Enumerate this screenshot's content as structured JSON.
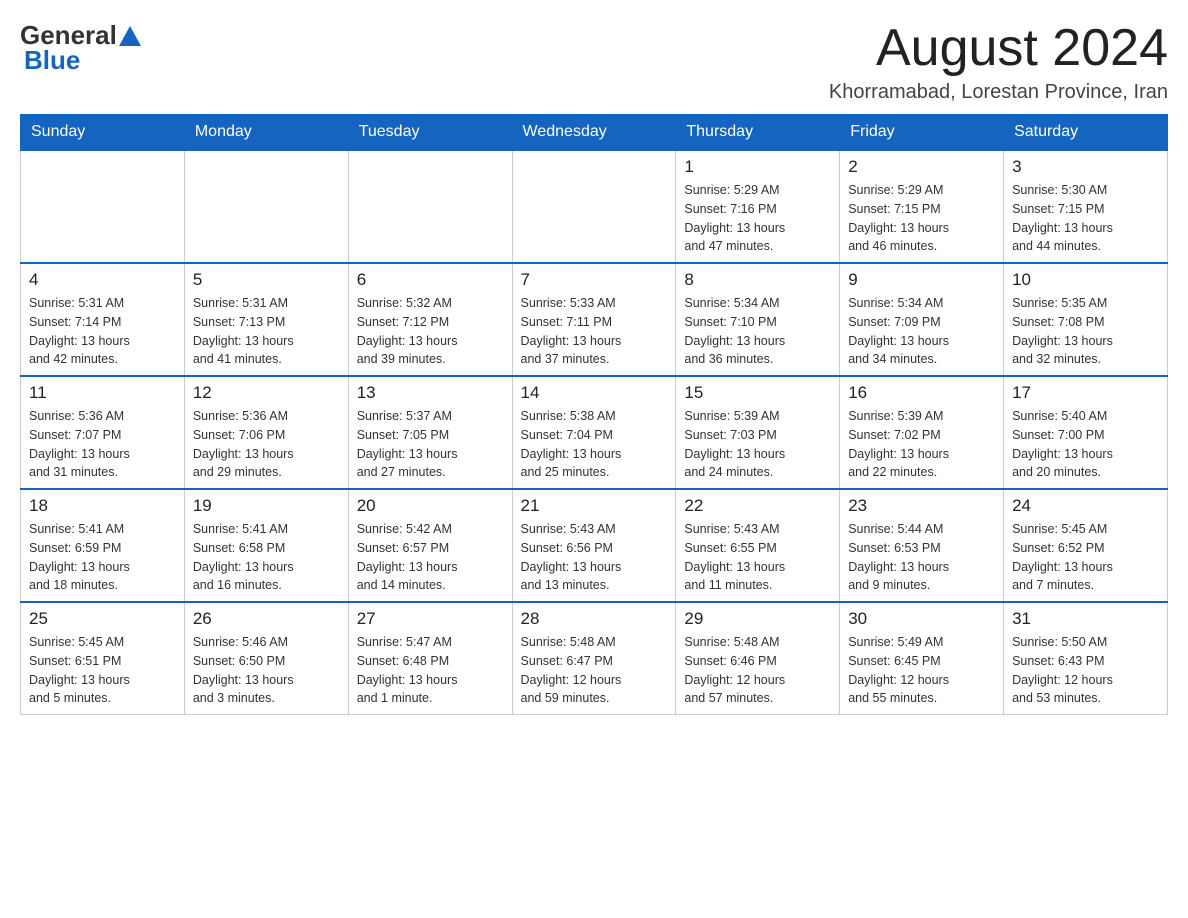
{
  "header": {
    "logo": {
      "text_general": "General",
      "text_blue": "Blue"
    },
    "title": "August 2024",
    "location": "Khorramabad, Lorestan Province, Iran"
  },
  "days_of_week": [
    "Sunday",
    "Monday",
    "Tuesday",
    "Wednesday",
    "Thursday",
    "Friday",
    "Saturday"
  ],
  "weeks": [
    [
      {
        "day": "",
        "info": ""
      },
      {
        "day": "",
        "info": ""
      },
      {
        "day": "",
        "info": ""
      },
      {
        "day": "",
        "info": ""
      },
      {
        "day": "1",
        "info": "Sunrise: 5:29 AM\nSunset: 7:16 PM\nDaylight: 13 hours\nand 47 minutes."
      },
      {
        "day": "2",
        "info": "Sunrise: 5:29 AM\nSunset: 7:15 PM\nDaylight: 13 hours\nand 46 minutes."
      },
      {
        "day": "3",
        "info": "Sunrise: 5:30 AM\nSunset: 7:15 PM\nDaylight: 13 hours\nand 44 minutes."
      }
    ],
    [
      {
        "day": "4",
        "info": "Sunrise: 5:31 AM\nSunset: 7:14 PM\nDaylight: 13 hours\nand 42 minutes."
      },
      {
        "day": "5",
        "info": "Sunrise: 5:31 AM\nSunset: 7:13 PM\nDaylight: 13 hours\nand 41 minutes."
      },
      {
        "day": "6",
        "info": "Sunrise: 5:32 AM\nSunset: 7:12 PM\nDaylight: 13 hours\nand 39 minutes."
      },
      {
        "day": "7",
        "info": "Sunrise: 5:33 AM\nSunset: 7:11 PM\nDaylight: 13 hours\nand 37 minutes."
      },
      {
        "day": "8",
        "info": "Sunrise: 5:34 AM\nSunset: 7:10 PM\nDaylight: 13 hours\nand 36 minutes."
      },
      {
        "day": "9",
        "info": "Sunrise: 5:34 AM\nSunset: 7:09 PM\nDaylight: 13 hours\nand 34 minutes."
      },
      {
        "day": "10",
        "info": "Sunrise: 5:35 AM\nSunset: 7:08 PM\nDaylight: 13 hours\nand 32 minutes."
      }
    ],
    [
      {
        "day": "11",
        "info": "Sunrise: 5:36 AM\nSunset: 7:07 PM\nDaylight: 13 hours\nand 31 minutes."
      },
      {
        "day": "12",
        "info": "Sunrise: 5:36 AM\nSunset: 7:06 PM\nDaylight: 13 hours\nand 29 minutes."
      },
      {
        "day": "13",
        "info": "Sunrise: 5:37 AM\nSunset: 7:05 PM\nDaylight: 13 hours\nand 27 minutes."
      },
      {
        "day": "14",
        "info": "Sunrise: 5:38 AM\nSunset: 7:04 PM\nDaylight: 13 hours\nand 25 minutes."
      },
      {
        "day": "15",
        "info": "Sunrise: 5:39 AM\nSunset: 7:03 PM\nDaylight: 13 hours\nand 24 minutes."
      },
      {
        "day": "16",
        "info": "Sunrise: 5:39 AM\nSunset: 7:02 PM\nDaylight: 13 hours\nand 22 minutes."
      },
      {
        "day": "17",
        "info": "Sunrise: 5:40 AM\nSunset: 7:00 PM\nDaylight: 13 hours\nand 20 minutes."
      }
    ],
    [
      {
        "day": "18",
        "info": "Sunrise: 5:41 AM\nSunset: 6:59 PM\nDaylight: 13 hours\nand 18 minutes."
      },
      {
        "day": "19",
        "info": "Sunrise: 5:41 AM\nSunset: 6:58 PM\nDaylight: 13 hours\nand 16 minutes."
      },
      {
        "day": "20",
        "info": "Sunrise: 5:42 AM\nSunset: 6:57 PM\nDaylight: 13 hours\nand 14 minutes."
      },
      {
        "day": "21",
        "info": "Sunrise: 5:43 AM\nSunset: 6:56 PM\nDaylight: 13 hours\nand 13 minutes."
      },
      {
        "day": "22",
        "info": "Sunrise: 5:43 AM\nSunset: 6:55 PM\nDaylight: 13 hours\nand 11 minutes."
      },
      {
        "day": "23",
        "info": "Sunrise: 5:44 AM\nSunset: 6:53 PM\nDaylight: 13 hours\nand 9 minutes."
      },
      {
        "day": "24",
        "info": "Sunrise: 5:45 AM\nSunset: 6:52 PM\nDaylight: 13 hours\nand 7 minutes."
      }
    ],
    [
      {
        "day": "25",
        "info": "Sunrise: 5:45 AM\nSunset: 6:51 PM\nDaylight: 13 hours\nand 5 minutes."
      },
      {
        "day": "26",
        "info": "Sunrise: 5:46 AM\nSunset: 6:50 PM\nDaylight: 13 hours\nand 3 minutes."
      },
      {
        "day": "27",
        "info": "Sunrise: 5:47 AM\nSunset: 6:48 PM\nDaylight: 13 hours\nand 1 minute."
      },
      {
        "day": "28",
        "info": "Sunrise: 5:48 AM\nSunset: 6:47 PM\nDaylight: 12 hours\nand 59 minutes."
      },
      {
        "day": "29",
        "info": "Sunrise: 5:48 AM\nSunset: 6:46 PM\nDaylight: 12 hours\nand 57 minutes."
      },
      {
        "day": "30",
        "info": "Sunrise: 5:49 AM\nSunset: 6:45 PM\nDaylight: 12 hours\nand 55 minutes."
      },
      {
        "day": "31",
        "info": "Sunrise: 5:50 AM\nSunset: 6:43 PM\nDaylight: 12 hours\nand 53 minutes."
      }
    ]
  ]
}
